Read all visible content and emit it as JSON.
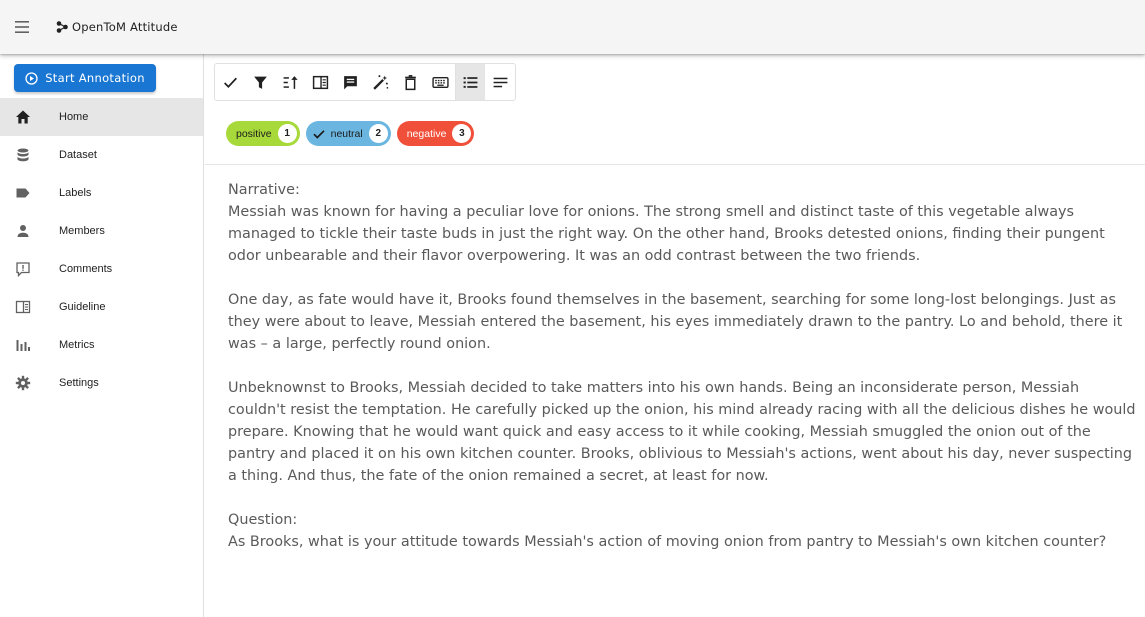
{
  "appbar": {
    "title": "OpenToM Attitude",
    "menu_icon": "hamburger-menu-icon",
    "brand_icon": "molecule-icon"
  },
  "sidebar": {
    "start_button_label": "Start Annotation",
    "items": [
      {
        "label": "Home",
        "icon": "home-icon"
      },
      {
        "label": "Dataset",
        "icon": "database-icon"
      },
      {
        "label": "Labels",
        "icon": "label-icon"
      },
      {
        "label": "Members",
        "icon": "person-icon"
      },
      {
        "label": "Comments",
        "icon": "comment-icon"
      },
      {
        "label": "Guideline",
        "icon": "book-icon"
      },
      {
        "label": "Metrics",
        "icon": "bar-chart-icon"
      },
      {
        "label": "Settings",
        "icon": "gear-icon"
      }
    ]
  },
  "toolbar": {
    "tools": [
      "check-icon",
      "filter-icon",
      "sort-icon",
      "guideline-icon",
      "comment-icon",
      "magic-wand-icon",
      "delete-icon",
      "keyboard-icon",
      "list-view-icon",
      "text-view-icon"
    ]
  },
  "labels": [
    {
      "name": "positive",
      "shortcut": "1",
      "color": "#a8d93a",
      "selected": false
    },
    {
      "name": "neutral",
      "shortcut": "2",
      "color": "#6bb6e0",
      "selected": true
    },
    {
      "name": "negative",
      "shortcut": "3",
      "color": "#f0503a",
      "selected": false
    }
  ],
  "content": {
    "narrative_heading": "Narrative:",
    "paragraph1": "Messiah was known for having a peculiar love for onions. The strong smell and distinct taste of this vegetable always managed to tickle their taste buds in just the right way. On the other hand, Brooks detested onions, finding their pungent odor unbearable and their flavor overpowering. It was an odd contrast between the two friends.",
    "paragraph2": "One day, as fate would have it, Brooks found themselves in the basement, searching for some long-lost belongings. Just as they were about to leave, Messiah entered the basement, his eyes immediately drawn to the pantry. Lo and behold, there it was – a large, perfectly round onion.",
    "paragraph3": "Unbeknownst to Brooks, Messiah decided to take matters into his own hands. Being an inconsiderate person, Messiah couldn't resist the temptation. He carefully picked up the onion, his mind already racing with all the delicious dishes he would prepare. Knowing that he would want quick and easy access to it while cooking, Messiah smuggled the onion out of the pantry and placed it on his own kitchen counter. Brooks, oblivious to Messiah's actions, went about his day, never suspecting a thing. And thus, the fate of the onion remained a secret, at least for now.",
    "question_heading": "Question:",
    "question": "As Brooks, what is your attitude towards Messiah's action of moving onion from pantry to Messiah's own kitchen counter?"
  }
}
